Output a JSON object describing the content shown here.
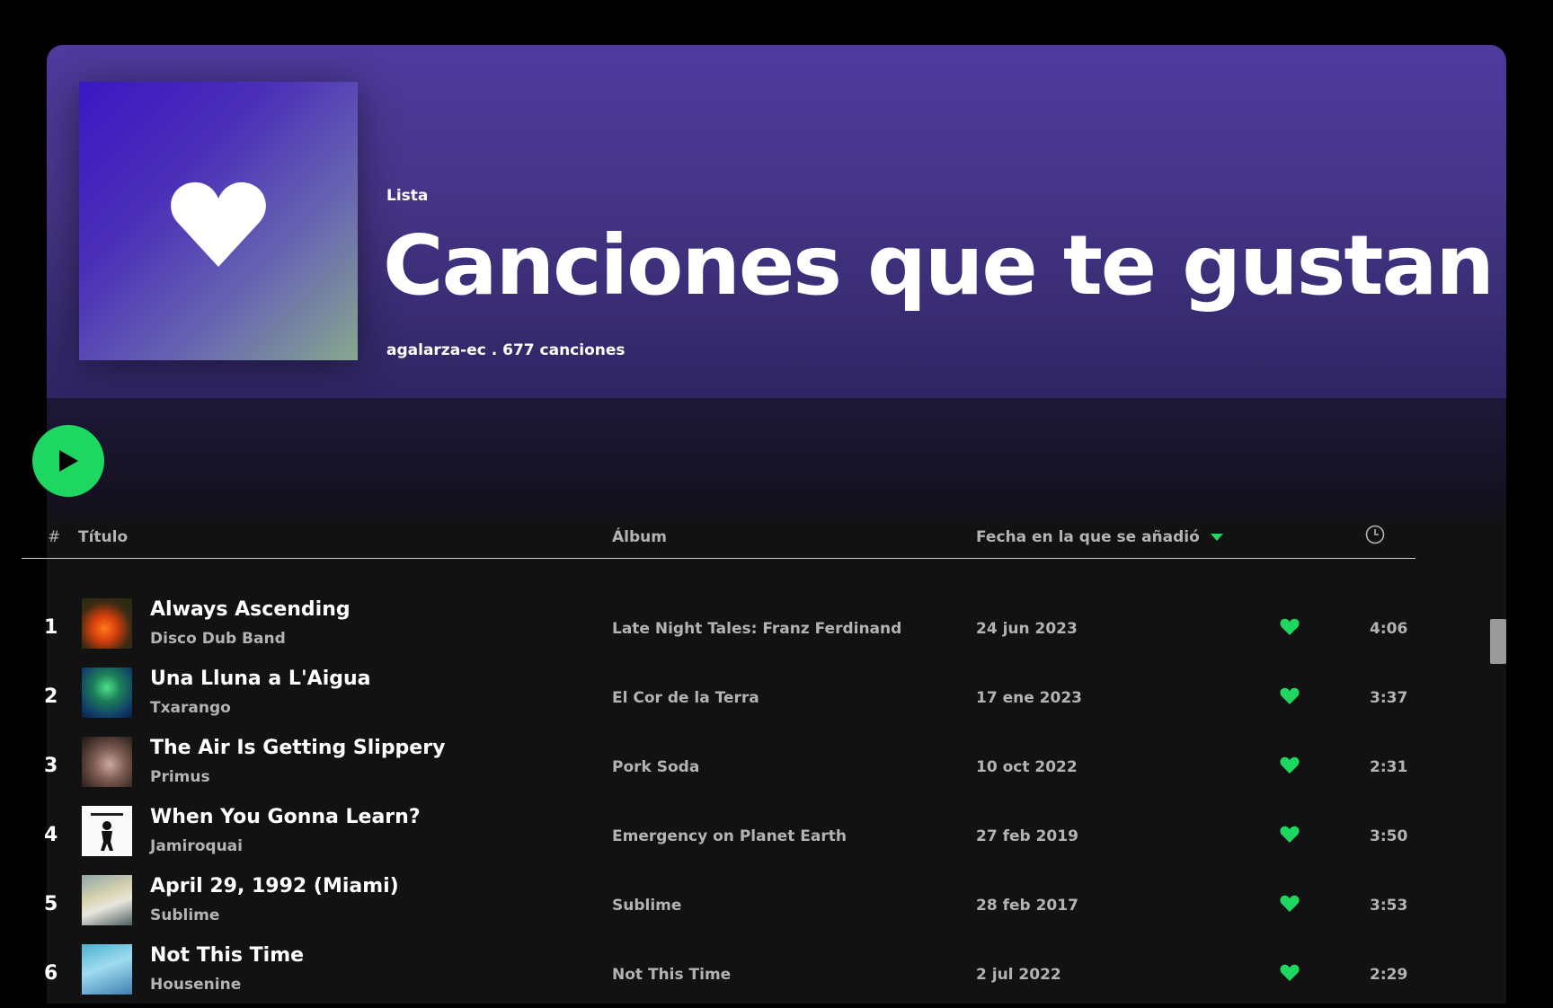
{
  "header": {
    "type_label": "Lista",
    "title": "Canciones que te gustan",
    "meta": "agalarza-ec . 677 canciones"
  },
  "cover": {
    "icon": "heart-icon",
    "gradient": [
      "#3a17c4",
      "#86a88e"
    ]
  },
  "controls": {
    "play_icon": "play-icon",
    "play_color": "#1ed760"
  },
  "table": {
    "headers": {
      "number": "#",
      "title": "Título",
      "album": "Álbum",
      "date_added": "Fecha en la que se añadió",
      "duration_icon": "clock-icon"
    },
    "sort_icon": "sort-down-icon",
    "accent": "#1ed760",
    "rows": [
      {
        "number": "1",
        "title": "Always Ascending",
        "artist": "Disco Dub Band",
        "album": "Late Night Tales: Franz Ferdinand",
        "date": "24 jun 2023",
        "duration": "4:06"
      },
      {
        "number": "2",
        "title": "Una Lluna a L'Aigua",
        "artist": "Txarango",
        "album": "El Cor de la Terra",
        "date": "17 ene 2023",
        "duration": "3:37"
      },
      {
        "number": "3",
        "title": "The Air Is Getting Slippery",
        "artist": "Primus",
        "album": "Pork Soda",
        "date": "10 oct 2022",
        "duration": "2:31"
      },
      {
        "number": "4",
        "title": "When You Gonna Learn?",
        "artist": "Jamiroquai",
        "album": "Emergency on Planet Earth",
        "date": "27 feb 2019",
        "duration": "3:50"
      },
      {
        "number": "5",
        "title": "April 29, 1992 (Miami)",
        "artist": "Sublime",
        "album": "Sublime",
        "date": "28 feb 2017",
        "duration": "3:53"
      },
      {
        "number": "6",
        "title": "Not This Time",
        "artist": "Housenine",
        "album": "Not This Time",
        "date": "2 jul 2022",
        "duration": "2:29"
      }
    ]
  }
}
